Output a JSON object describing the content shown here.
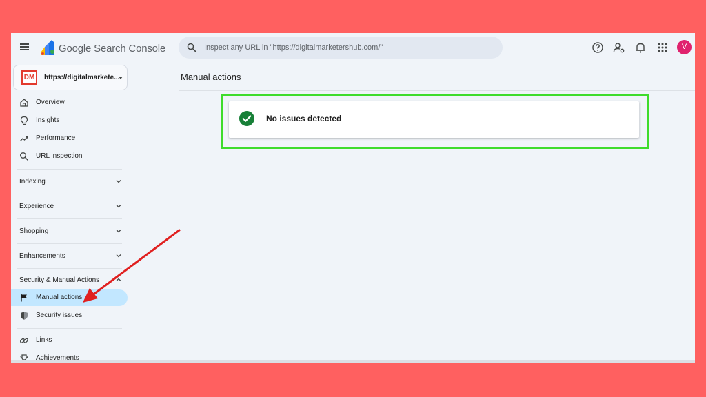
{
  "app": {
    "brand_prefix": "Google",
    "brand_name": "Search Console"
  },
  "search": {
    "placeholder": "Inspect any URL in \"https://digitalmarketershub.com/\""
  },
  "toolbar": {
    "icons": [
      "help-icon",
      "manage-users-icon",
      "notifications-icon",
      "apps-grid-icon"
    ],
    "avatar_letter": "V",
    "avatar_color": "#e0226e"
  },
  "property": {
    "badge": "DM",
    "name": "https://digitalmarkete..."
  },
  "sidebar": {
    "top_items": [
      {
        "label": "Overview",
        "icon": "home-icon"
      },
      {
        "label": "Insights",
        "icon": "lightbulb-icon"
      },
      {
        "label": "Performance",
        "icon": "trending-up-icon"
      },
      {
        "label": "URL inspection",
        "icon": "search-icon"
      }
    ],
    "groups": [
      {
        "label": "Indexing",
        "expanded": false
      },
      {
        "label": "Experience",
        "expanded": false
      },
      {
        "label": "Shopping",
        "expanded": false
      },
      {
        "label": "Enhancements",
        "expanded": false
      },
      {
        "label": "Security & Manual Actions",
        "expanded": true
      }
    ],
    "security_items": [
      {
        "label": "Manual actions",
        "icon": "flag-icon",
        "active": true
      },
      {
        "label": "Security issues",
        "icon": "shield-icon",
        "active": false
      }
    ],
    "bottom_items": [
      {
        "label": "Links",
        "icon": "link-icon"
      },
      {
        "label": "Achievements",
        "icon": "trophy-icon"
      }
    ]
  },
  "main": {
    "title": "Manual actions",
    "status_message": "No issues detected",
    "status_icon": "check-circle-icon",
    "status_color": "#188038"
  },
  "annotations": {
    "highlight_color": "#3fdc2c",
    "arrow_color": "#e02020"
  }
}
